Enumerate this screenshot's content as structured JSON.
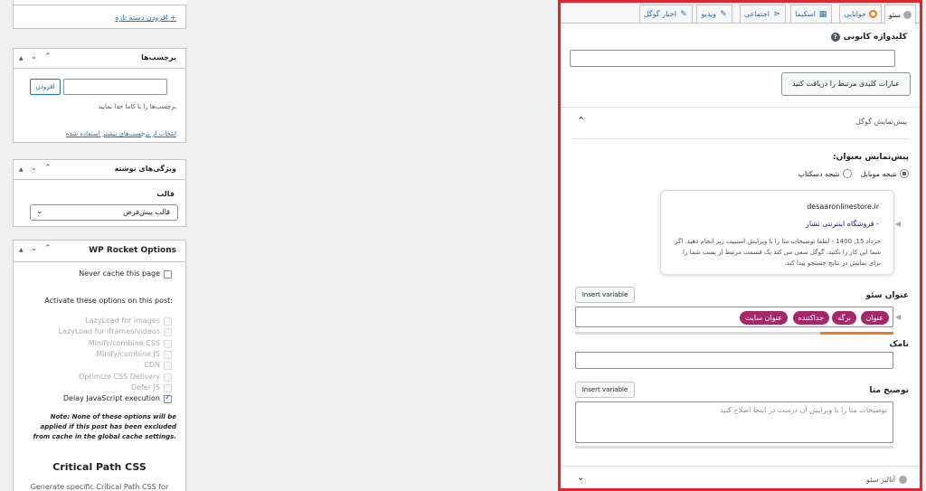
{
  "sidebar": {
    "categories": {
      "add_link": "+ افزودن دسته تازه"
    },
    "tags": {
      "title": "برچسب‌ها",
      "add_button": "افزودن",
      "hint": "برچسب‌ها را با کاما جدا نمایید",
      "choose_link": "انتخاب از برچسب‌های بیشتر استفاده شده"
    },
    "post_attributes": {
      "title": "ویژگی‌های نوشته",
      "template_label": "قالب",
      "template_value": "قالب پیش‌فرض"
    },
    "wp_rocket": {
      "title": "WP Rocket Options",
      "never_cache": "Never cache this page",
      "activate_title": "Activate these options on this post:",
      "options": [
        {
          "label": "LazyLoad for images",
          "disabled": true,
          "checked": false
        },
        {
          "label": "LazyLoad for iframes/videos",
          "disabled": true,
          "checked": false
        },
        {
          "label": "Minify/combine CSS",
          "disabled": true,
          "checked": false
        },
        {
          "label": "Minify/combine JS",
          "disabled": true,
          "checked": false
        },
        {
          "label": "CDN",
          "disabled": true,
          "checked": false
        },
        {
          "label": "Optimize CSS Delivery",
          "disabled": true,
          "checked": false
        },
        {
          "label": "Defer JS",
          "disabled": true,
          "checked": false
        },
        {
          "label": "Delay JavaScript execution",
          "disabled": false,
          "checked": true
        }
      ],
      "note": "Note: None of these options will be applied if this post has been excluded from cache in the global cache settings.",
      "critical_title": "Critical Path CSS",
      "generate_text": "Generate specific Critical Path CSS for"
    }
  },
  "yoast": {
    "tabs": [
      {
        "label": "سئو",
        "icon": "status-dot-icon",
        "active": true
      },
      {
        "label": "خوانایی",
        "icon": "readability-icon",
        "active": false
      },
      {
        "label": "اسکیما",
        "icon": "grid-icon",
        "active": false
      },
      {
        "label": "اجتماعی",
        "icon": "share-icon",
        "active": false
      },
      {
        "label": "ویدیو",
        "icon": "video-plugin-icon",
        "active": false
      },
      {
        "label": "اخبار گوگل",
        "icon": "news-plugin-icon",
        "active": false
      }
    ],
    "focus_keyphrase_label": "کلیدواژه کانونی",
    "related_button": "عبارات کلیدی مرتبط را دریافت کنید",
    "google_preview_label": "پیش‌نمایش گوگل",
    "preview_as_label": "پیش‌نمایش بعنوان:",
    "radio_mobile": "نتیجه موبایل",
    "radio_desktop": "نتیجه دسکتاپ",
    "preview": {
      "url": "desaaronlinestore.ir",
      "title": "- فروشگاه اینترنتی نشار",
      "description": "خرداد 15, 1400 - لطفا توضیحات متا را با ویرایش اسنیپت زیر انجام دهید. اگر شما این کار را نکنید، گوگل سعی می کند یک قسمت مرتبط از پست شما را برای نمایش در نتایج جستجو پیدا کند."
    },
    "seo_title_label": "عنوان سئو",
    "insert_variable": "Insert variable",
    "title_pills": [
      "عنوان",
      "برگه",
      "جداکننده",
      "عنوان سایت"
    ],
    "title_progress": 0.23,
    "slug_label": "نامک",
    "meta_desc_label": "توضیح متا",
    "meta_desc_placeholder": "توضیحات متا را با ویرایش آن درست در اینجا اصلاح کنید",
    "analysis_label": "آنالیز سئو",
    "colors": {
      "accent_border": "#e0262d",
      "pill": "#a4286a",
      "progress": "#ee7c1b"
    }
  }
}
